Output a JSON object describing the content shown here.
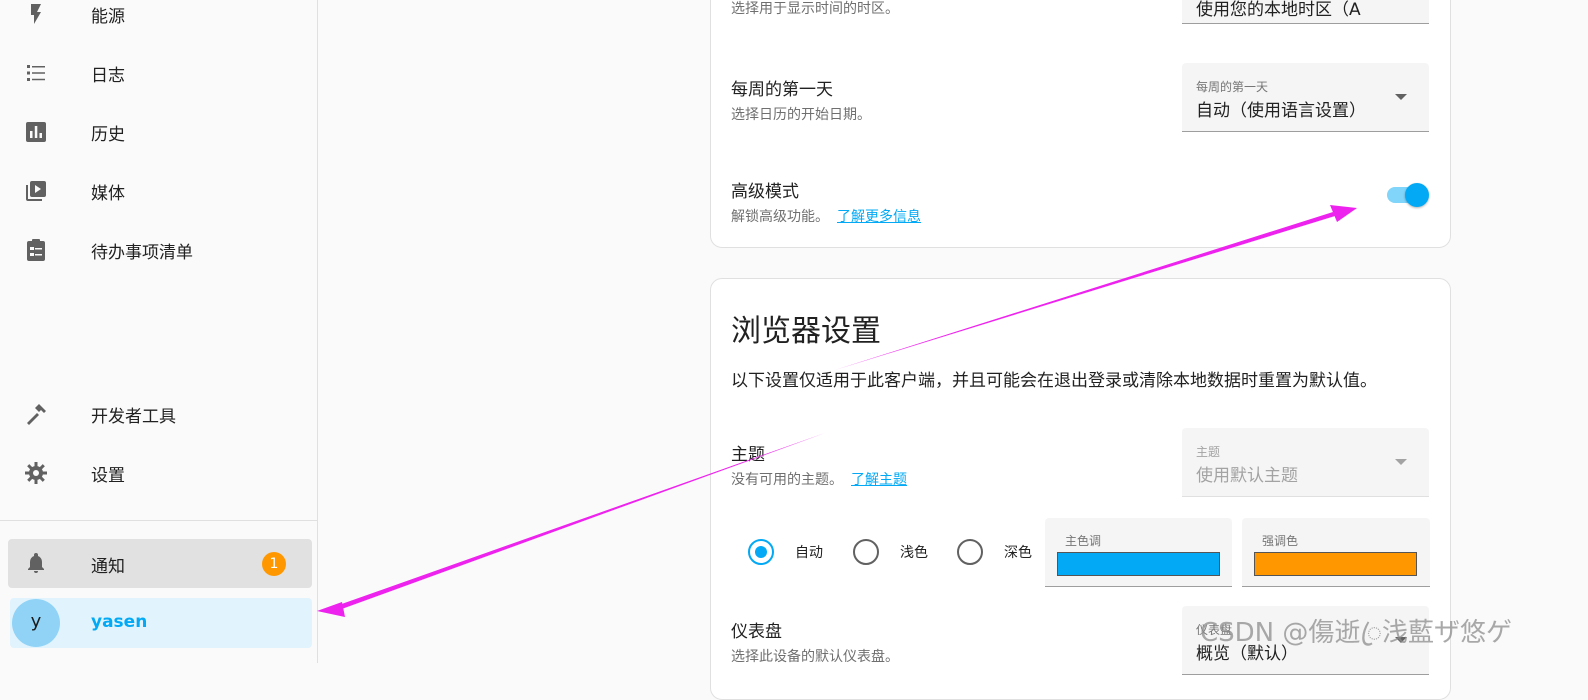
{
  "sidebar": {
    "items": [
      {
        "label": "能源",
        "icon": "lightning-icon"
      },
      {
        "label": "日志",
        "icon": "list-icon"
      },
      {
        "label": "历史",
        "icon": "chart-icon"
      },
      {
        "label": "媒体",
        "icon": "media-icon"
      },
      {
        "label": "待办事项清单",
        "icon": "clipboard-list-icon"
      }
    ],
    "bottom_items": [
      {
        "label": "开发者工具",
        "icon": "hammer-icon"
      },
      {
        "label": "设置",
        "icon": "gear-icon"
      }
    ],
    "notifications": {
      "label": "通知",
      "badge": "1"
    },
    "user": {
      "initial": "y",
      "name": "yasen"
    }
  },
  "general_card": {
    "timezone_desc": "选择用于显示时间的时区。",
    "timezone_value": "使用您的本地时区（A",
    "first_weekday": {
      "title": "每周的第一天",
      "desc": "选择日历的开始日期。",
      "select_label": "每周的第一天",
      "select_value": "自动（使用语言设置）"
    },
    "advanced_mode": {
      "title": "高级模式",
      "desc": "解锁高级功能。",
      "link": "了解更多信息",
      "enabled": true
    }
  },
  "browser_card": {
    "title": "浏览器设置",
    "desc": "以下设置仅适用于此客户端，并且可能会在退出登录或清除本地数据时重置为默认值。",
    "theme": {
      "title": "主题",
      "desc": "没有可用的主题。",
      "link": "了解主题",
      "select_label": "主题",
      "select_value": "使用默认主题"
    },
    "modes": [
      {
        "label": "自动",
        "selected": true
      },
      {
        "label": "浅色",
        "selected": false
      },
      {
        "label": "深色",
        "selected": false
      }
    ],
    "primary_color": {
      "label": "主色调",
      "color": "#03a9f4"
    },
    "accent_color": {
      "label": "强调色",
      "color": "#ff9800"
    },
    "dashboard": {
      "title": "仪表盘",
      "desc": "选择此设备的默认仪表盘。",
      "select_label": "仪表盘",
      "select_value": "概览（默认）"
    }
  },
  "annotation": {
    "arrow_color": "#ee22ee"
  },
  "watermark": "CSDN @傷逝ꦿ浅藍ザ悠ゲ"
}
